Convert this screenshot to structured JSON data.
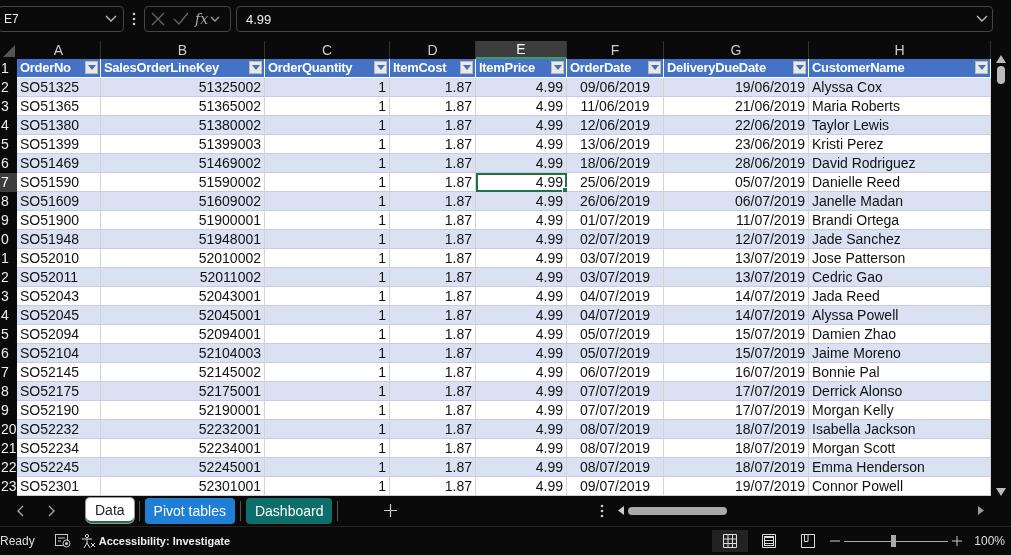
{
  "name_box": "E7",
  "formula_bar": {
    "value": "4.99",
    "fx": "fx"
  },
  "columns": [
    {
      "letter": "A",
      "selected": false
    },
    {
      "letter": "B",
      "selected": false
    },
    {
      "letter": "C",
      "selected": false
    },
    {
      "letter": "D",
      "selected": false
    },
    {
      "letter": "E",
      "selected": true
    },
    {
      "letter": "F",
      "selected": false
    },
    {
      "letter": "G",
      "selected": false
    },
    {
      "letter": "H",
      "selected": false
    }
  ],
  "header_row": {
    "n": "1",
    "cells": [
      "OrderNo",
      "SalesOrderLineKey",
      "OrderQuantity",
      "ItemCost",
      "ItemPrice",
      "OrderDate",
      "DeliveryDueDate",
      "CustomerName"
    ]
  },
  "rows": [
    {
      "n": "2",
      "selected": false,
      "cells": [
        "SO51325",
        "51325002",
        "1",
        "1.87",
        "4.99",
        "09/06/2019",
        "19/06/2019",
        "Alyssa Cox"
      ]
    },
    {
      "n": "3",
      "selected": false,
      "cells": [
        "SO51365",
        "51365002",
        "1",
        "1.87",
        "4.99",
        "11/06/2019",
        "21/06/2019",
        "Maria Roberts"
      ]
    },
    {
      "n": "4",
      "selected": false,
      "cells": [
        "SO51380",
        "51380002",
        "1",
        "1.87",
        "4.99",
        "12/06/2019",
        "22/06/2019",
        "Taylor Lewis"
      ]
    },
    {
      "n": "5",
      "selected": false,
      "cells": [
        "SO51399",
        "51399003",
        "1",
        "1.87",
        "4.99",
        "13/06/2019",
        "23/06/2019",
        "Kristi Perez"
      ]
    },
    {
      "n": "6",
      "selected": false,
      "cells": [
        "SO51469",
        "51469002",
        "1",
        "1.87",
        "4.99",
        "18/06/2019",
        "28/06/2019",
        "David Rodriguez"
      ]
    },
    {
      "n": "7",
      "selected": true,
      "cells": [
        "SO51590",
        "51590002",
        "1",
        "1.87",
        "4.99",
        "25/06/2019",
        "05/07/2019",
        "Danielle Reed"
      ]
    },
    {
      "n": "8",
      "selected": false,
      "cells": [
        "SO51609",
        "51609002",
        "1",
        "1.87",
        "4.99",
        "26/06/2019",
        "06/07/2019",
        "Janelle Madan"
      ]
    },
    {
      "n": "9",
      "selected": false,
      "cells": [
        "SO51900",
        "51900001",
        "1",
        "1.87",
        "4.99",
        "01/07/2019",
        "11/07/2019",
        "Brandi Ortega"
      ]
    },
    {
      "n": "0",
      "selected": false,
      "cells": [
        "SO51948",
        "51948001",
        "1",
        "1.87",
        "4.99",
        "02/07/2019",
        "12/07/2019",
        "Jade Sanchez"
      ]
    },
    {
      "n": "1",
      "selected": false,
      "cells": [
        "SO52010",
        "52010002",
        "1",
        "1.87",
        "4.99",
        "03/07/2019",
        "13/07/2019",
        "Jose Patterson"
      ]
    },
    {
      "n": "2",
      "selected": false,
      "cells": [
        "SO52011",
        "52011002",
        "1",
        "1.87",
        "4.99",
        "03/07/2019",
        "13/07/2019",
        "Cedric Gao"
      ]
    },
    {
      "n": "3",
      "selected": false,
      "cells": [
        "SO52043",
        "52043001",
        "1",
        "1.87",
        "4.99",
        "04/07/2019",
        "14/07/2019",
        "Jada Reed"
      ]
    },
    {
      "n": "4",
      "selected": false,
      "cells": [
        "SO52045",
        "52045001",
        "1",
        "1.87",
        "4.99",
        "04/07/2019",
        "14/07/2019",
        "Alyssa Powell"
      ]
    },
    {
      "n": "5",
      "selected": false,
      "cells": [
        "SO52094",
        "52094001",
        "1",
        "1.87",
        "4.99",
        "05/07/2019",
        "15/07/2019",
        "Damien Zhao"
      ]
    },
    {
      "n": "6",
      "selected": false,
      "cells": [
        "SO52104",
        "52104003",
        "1",
        "1.87",
        "4.99",
        "05/07/2019",
        "15/07/2019",
        "Jaime Moreno"
      ]
    },
    {
      "n": "7",
      "selected": false,
      "cells": [
        "SO52145",
        "52145002",
        "1",
        "1.87",
        "4.99",
        "06/07/2019",
        "16/07/2019",
        "Bonnie Pal"
      ]
    },
    {
      "n": "8",
      "selected": false,
      "cells": [
        "SO52175",
        "52175001",
        "1",
        "1.87",
        "4.99",
        "07/07/2019",
        "17/07/2019",
        "Derrick Alonso"
      ]
    },
    {
      "n": "9",
      "selected": false,
      "cells": [
        "SO52190",
        "52190001",
        "1",
        "1.87",
        "4.99",
        "07/07/2019",
        "17/07/2019",
        "Morgan Kelly"
      ]
    },
    {
      "n": "20",
      "selected": false,
      "cells": [
        "SO52232",
        "52232001",
        "1",
        "1.87",
        "4.99",
        "08/07/2019",
        "18/07/2019",
        "Isabella Jackson"
      ]
    },
    {
      "n": "21",
      "selected": false,
      "cells": [
        "SO52234",
        "52234001",
        "1",
        "1.87",
        "4.99",
        "08/07/2019",
        "18/07/2019",
        "Morgan Scott"
      ]
    },
    {
      "n": "22",
      "selected": false,
      "cells": [
        "SO52245",
        "52245001",
        "1",
        "1.87",
        "4.99",
        "08/07/2019",
        "18/07/2019",
        "Emma Henderson"
      ]
    },
    {
      "n": "23",
      "selected": false,
      "cells": [
        "SO52301",
        "52301001",
        "1",
        "1.87",
        "4.99",
        "09/07/2019",
        "19/07/2019",
        "Connor Powell"
      ]
    }
  ],
  "sheet_tabs": [
    {
      "label": "Data",
      "selected": true,
      "color": "#ffffff"
    },
    {
      "label": "Pivot tables",
      "selected": false,
      "color": "#1f7fd4"
    },
    {
      "label": "Dashboard",
      "selected": false,
      "color": "#0e6e69"
    }
  ],
  "status_bar": {
    "status": "Ready",
    "accessibility": "Accessibility: Investigate",
    "views": [
      {
        "kind": "normal",
        "selected": true
      },
      {
        "kind": "layout",
        "selected": false
      },
      {
        "kind": "pagebreak",
        "selected": false
      }
    ],
    "zoom": {
      "level": 0.47,
      "reading": "100%"
    }
  }
}
